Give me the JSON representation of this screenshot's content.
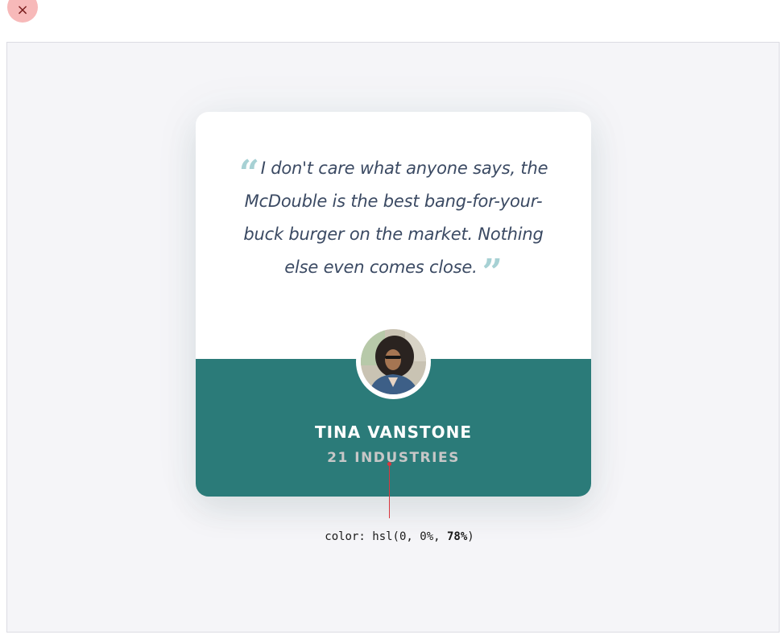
{
  "toolbar": {
    "close_glyph": "×"
  },
  "testimonial": {
    "quote_open": "“",
    "quote_text": "I don't care what anyone says, the McDouble is the best bang-for-your-buck burger on the market. Nothing else even comes close.",
    "quote_close": "”",
    "author_name": "TINA VANSTONE",
    "author_company": "21 INDUSTRIES"
  },
  "inspector": {
    "prefix": "color: hsl(0, 0%, ",
    "highlight": "78%",
    "suffix": ")"
  },
  "colors": {
    "card_bottom": "#2b7b79",
    "quote_mark": "#a7d1d4",
    "quote_text": "#3b4a63",
    "company_text": "#c7c7c7",
    "pointer": "#d9363e"
  }
}
